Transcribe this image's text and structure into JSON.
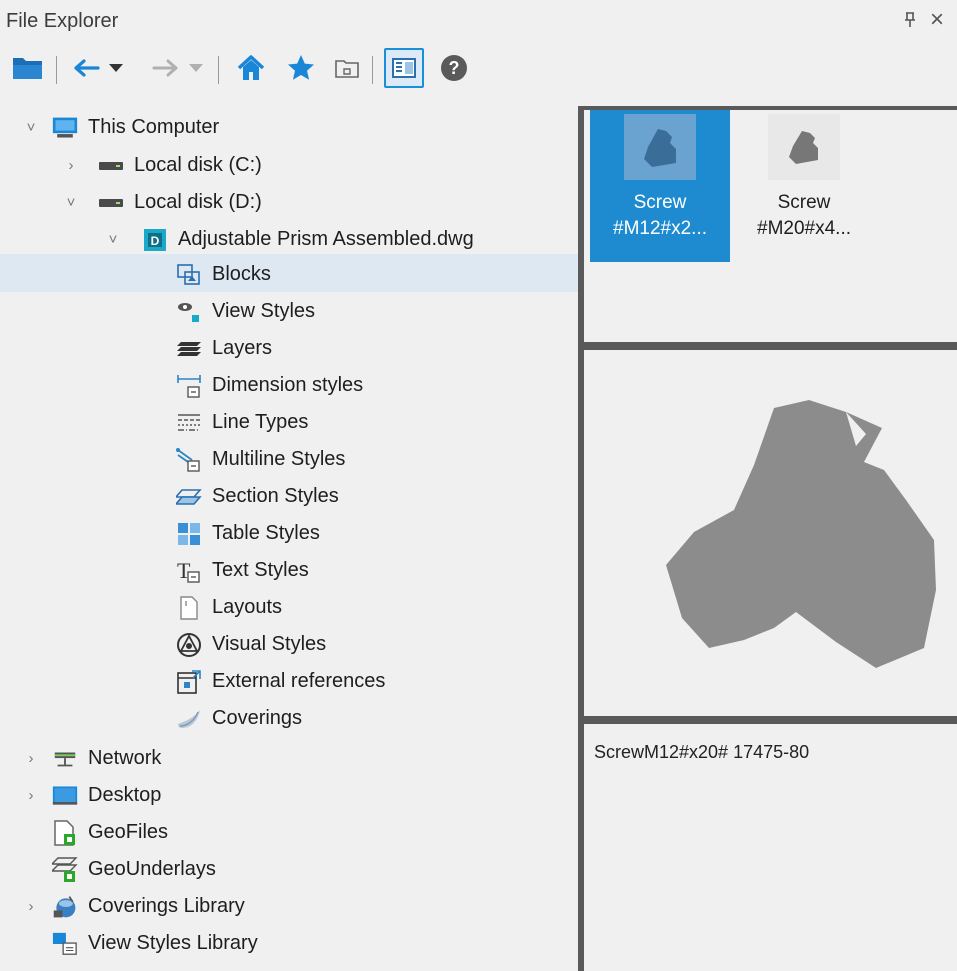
{
  "window": {
    "title": "File Explorer",
    "pin_glyph": "ᵖ",
    "close_glyph": "×"
  },
  "toolbar": {
    "buttons": [
      "open-folder-icon",
      "back-icon",
      "back-dropdown-icon",
      "forward-icon",
      "forward-dropdown-icon",
      "home-icon",
      "favorites-icon",
      "folder-up-icon",
      "preview-toggle-icon",
      "help-icon"
    ],
    "help_label": "?"
  },
  "tree": {
    "root": "This Computer",
    "disk_c": "Local disk (C:)",
    "disk_d": "Local disk (D:)",
    "drawing": "Adjustable Prism Assembled.dwg",
    "children": [
      "Blocks",
      "View Styles",
      "Layers",
      "Dimension styles",
      "Line Types",
      "Multiline Styles",
      "Section Styles",
      "Table Styles",
      "Text Styles",
      "Layouts",
      "Visual Styles",
      "External references",
      "Coverings"
    ],
    "bottom": [
      "Network",
      "Desktop",
      "GeoFiles",
      "GeoUnderlays",
      "Coverings Library",
      "View Styles Library"
    ],
    "selected": "Blocks"
  },
  "blocks": [
    {
      "line1": "Screw",
      "line2": "#M12#x2...",
      "selected": true
    },
    {
      "line1": "Screw",
      "line2": "#M20#x4...",
      "selected": false
    }
  ],
  "description": "ScrewM12#x20# 17475-80",
  "colors": {
    "accent": "#1e8bd0",
    "shape": "#8c8c8c",
    "divider": "#5a5a5a"
  }
}
